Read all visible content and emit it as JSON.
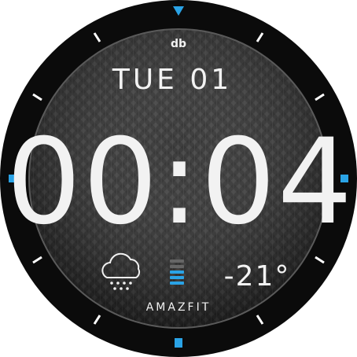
{
  "watch": {
    "brand_mark": "db",
    "date": "TUE 01",
    "time": "00:04",
    "temperature": "-21°",
    "brand": "AMAZFIT",
    "weather_icon": "snow-cloud-icon",
    "battery_icon": "battery-level-icon"
  },
  "colors": {
    "bezel": "#0b0b0b",
    "dial": "#2b2b2b",
    "accent": "#2aa3e6",
    "text": "#f2f2f2"
  }
}
